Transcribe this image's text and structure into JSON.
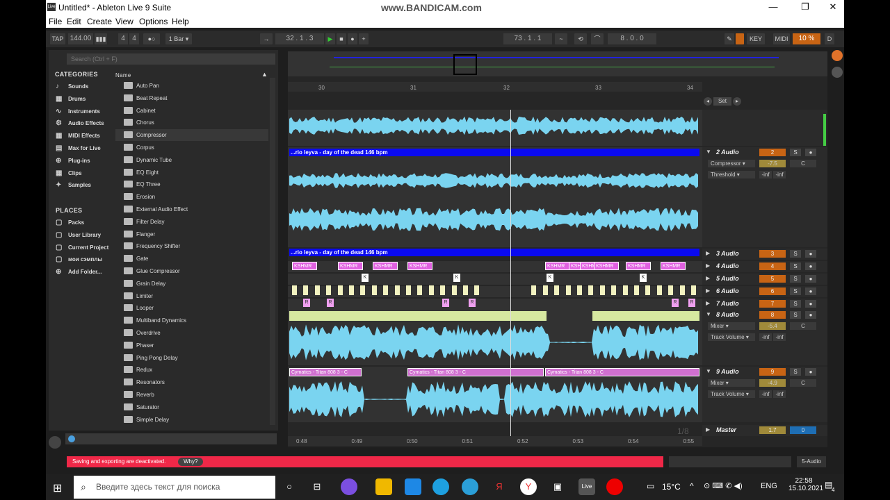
{
  "app": {
    "title": "Untitled* - Ableton Live 9 Suite",
    "icon_label": "Live",
    "watermark": "www.BANDICAM.com",
    "menu": [
      "File",
      "Edit",
      "Create",
      "View",
      "Options",
      "Help"
    ],
    "window_controls": [
      "—",
      "❐",
      "✕"
    ]
  },
  "transport": {
    "tap": "TAP",
    "tempo": "144.00",
    "meter_icon": "▮▮▮",
    "signature_num": "4",
    "signature_den": "4",
    "metronome": "●○",
    "quantize": "1 Bar ▾",
    "follow_icon": "→",
    "position": "32 . 1 . 3",
    "play_icon": "▶",
    "stop_icon": "■",
    "record_icon": "●",
    "overdub_icon": "+",
    "loop_start": "73 . 1 . 1",
    "punch_icons": [
      "~",
      "⟲",
      "⌒"
    ],
    "loop_length": "8 . 0 . 0",
    "draw_icon": "✎",
    "key": "KEY",
    "midi": "MIDI",
    "cpu": "10 %",
    "disk": "D"
  },
  "browser": {
    "search_placeholder": "Search (Ctrl + F)",
    "categories_title": "CATEGORIES",
    "name_column": "Name",
    "categories": [
      {
        "label": "Sounds",
        "icon": "♪"
      },
      {
        "label": "Drums",
        "icon": "▦"
      },
      {
        "label": "Instruments",
        "icon": "∿"
      },
      {
        "label": "Audio Effects",
        "icon": "⚙"
      },
      {
        "label": "MIDI Effects",
        "icon": "▦"
      },
      {
        "label": "Max for Live",
        "icon": "▤"
      },
      {
        "label": "Plug-ins",
        "icon": "⊕"
      },
      {
        "label": "Clips",
        "icon": "▦"
      },
      {
        "label": "Samples",
        "icon": "✦"
      }
    ],
    "places_title": "PLACES",
    "places": [
      {
        "label": "Packs",
        "icon": "▢"
      },
      {
        "label": "User Library",
        "icon": "▢"
      },
      {
        "label": "Current Project",
        "icon": "▢"
      },
      {
        "label": "мои сэмплы",
        "icon": "▢"
      },
      {
        "label": "Add Folder...",
        "icon": "⊕"
      }
    ],
    "items": [
      "Auto Pan",
      "Beat Repeat",
      "Cabinet",
      "Chorus",
      "Compressor",
      "Corpus",
      "Dynamic Tube",
      "EQ Eight",
      "EQ Three",
      "Erosion",
      "External Audio Effect",
      "Filter Delay",
      "Flanger",
      "Frequency Shifter",
      "Gate",
      "Glue Compressor",
      "Grain Delay",
      "Limiter",
      "Looper",
      "Multiband Dynamics",
      "Overdrive",
      "Phaser",
      "Ping Pong Delay",
      "Redux",
      "Resonators",
      "Reverb",
      "Saturator",
      "Simple Delay"
    ],
    "selected_item": "Compressor"
  },
  "arrangement": {
    "bars": [
      "30",
      "31",
      "32",
      "33",
      "34"
    ],
    "times": [
      "0:48",
      "0:49",
      "0:50",
      "0:51",
      "0:52",
      "0:53",
      "0:54",
      "0:55"
    ],
    "set_label": "Set",
    "page": "1/8",
    "clip_name": "...rio leyva - day of the dead 146 bpm",
    "kshmr_label": "KSHMR",
    "k_label": "K",
    "r_label": "R",
    "cymatics_label": "Cymatics - Titan 808 3 - C",
    "tracks": [
      {
        "name": "2 Audio",
        "num": "2",
        "device": "Compressor ▾",
        "param": "Threshold ▾",
        "val1": "-7.5",
        "val2": "C",
        "inf1": "-inf",
        "inf2": "-inf"
      },
      {
        "name": "3 Audio",
        "num": "3"
      },
      {
        "name": "4 Audio",
        "num": "4"
      },
      {
        "name": "5 Audio",
        "num": "5"
      },
      {
        "name": "6 Audio",
        "num": "6"
      },
      {
        "name": "7 Audio",
        "num": "7"
      },
      {
        "name": "8 Audio",
        "num": "8",
        "device": "Mixer ▾",
        "param": "Track Volume ▾",
        "val1": "-5.4",
        "val2": "C",
        "inf1": "-inf",
        "inf2": "-inf"
      },
      {
        "name": "9 Audio",
        "num": "9",
        "device": "Mixer ▾",
        "param": "Track Volume ▾",
        "val1": "-4.9",
        "val2": "C",
        "inf1": "-inf",
        "inf2": "-inf"
      }
    ],
    "master": {
      "name": "Master",
      "volume": "1.7",
      "send": "0"
    },
    "s_label": "S",
    "rec_label": "●"
  },
  "status": {
    "message": "Saving and exporting are deactivated.",
    "why": "Why?",
    "track_label": "5-Audio"
  },
  "taskbar": {
    "search_placeholder": "Введите здесь текст для поиска",
    "weather": "15°C",
    "lang": "ENG",
    "time": "22:58",
    "date": "15.10.2021",
    "notif_count": "4"
  },
  "colors": {
    "accent": "#c86414",
    "clip_blue": "#0a0af0",
    "wave": "#7ad4f0",
    "status_red": "#f02848"
  }
}
